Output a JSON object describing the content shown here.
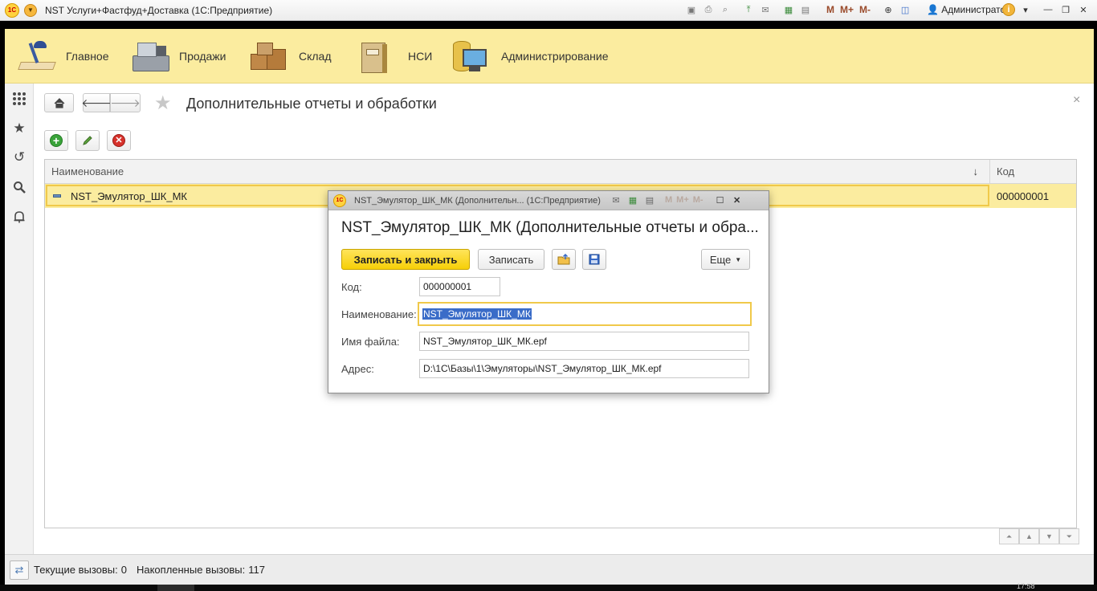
{
  "app": {
    "title": "NST Услуги+Фастфуд+Доставка  (1С:Предприятие)",
    "user": "Администратор",
    "m_buttons": [
      "M",
      "M+",
      "M-"
    ]
  },
  "sections": [
    {
      "label": "Главное",
      "icon": "desk-lamp-icon"
    },
    {
      "label": "Продажи",
      "icon": "cash-register-icon"
    },
    {
      "label": "Склад",
      "icon": "boxes-icon"
    },
    {
      "label": "НСИ",
      "icon": "binder-icon"
    },
    {
      "label": "Администрирование",
      "icon": "computer-database-icon"
    }
  ],
  "page": {
    "title": "Дополнительные отчеты и обработки"
  },
  "table": {
    "columns": {
      "name": "Наименование",
      "code": "Код"
    },
    "sort_indicator": "↓",
    "rows": [
      {
        "name": "NST_Эмулятор_ШК_МК",
        "code": "000000001"
      }
    ]
  },
  "status": {
    "current_calls_label": "Текущие вызовы:",
    "current_calls": "0",
    "total_calls_label": "Накопленные вызовы:",
    "total_calls": "117"
  },
  "taskbar": {
    "clock": "17:58"
  },
  "dialog": {
    "window_caption": "NST_Эмулятор_ШК_МК (Дополнительн...  (1С:Предприятие)",
    "heading": "NST_Эмулятор_ШК_МК (Дополнительные отчеты и обра...",
    "save_close_label": "Записать и закрыть",
    "save_label": "Записать",
    "more_label": "Еще",
    "fields": {
      "code_label": "Код:",
      "code_value": "000000001",
      "name_label": "Наименование:",
      "name_value": "NST_Эмулятор_ШК_МК",
      "file_label": "Имя файла:",
      "file_value": "NST_Эмулятор_ШК_МК.epf",
      "address_label": "Адрес:",
      "address_value": "D:\\1С\\Базы\\1\\Эмуляторы\\NST_Эмулятор_ШК_МК.epf"
    }
  },
  "colors": {
    "section_bg": "#fbec9f",
    "accent_yellow": "#f6cf08",
    "selection_border": "#f0c94a",
    "add_green": "#3aa33a",
    "delete_red": "#d6312b"
  }
}
